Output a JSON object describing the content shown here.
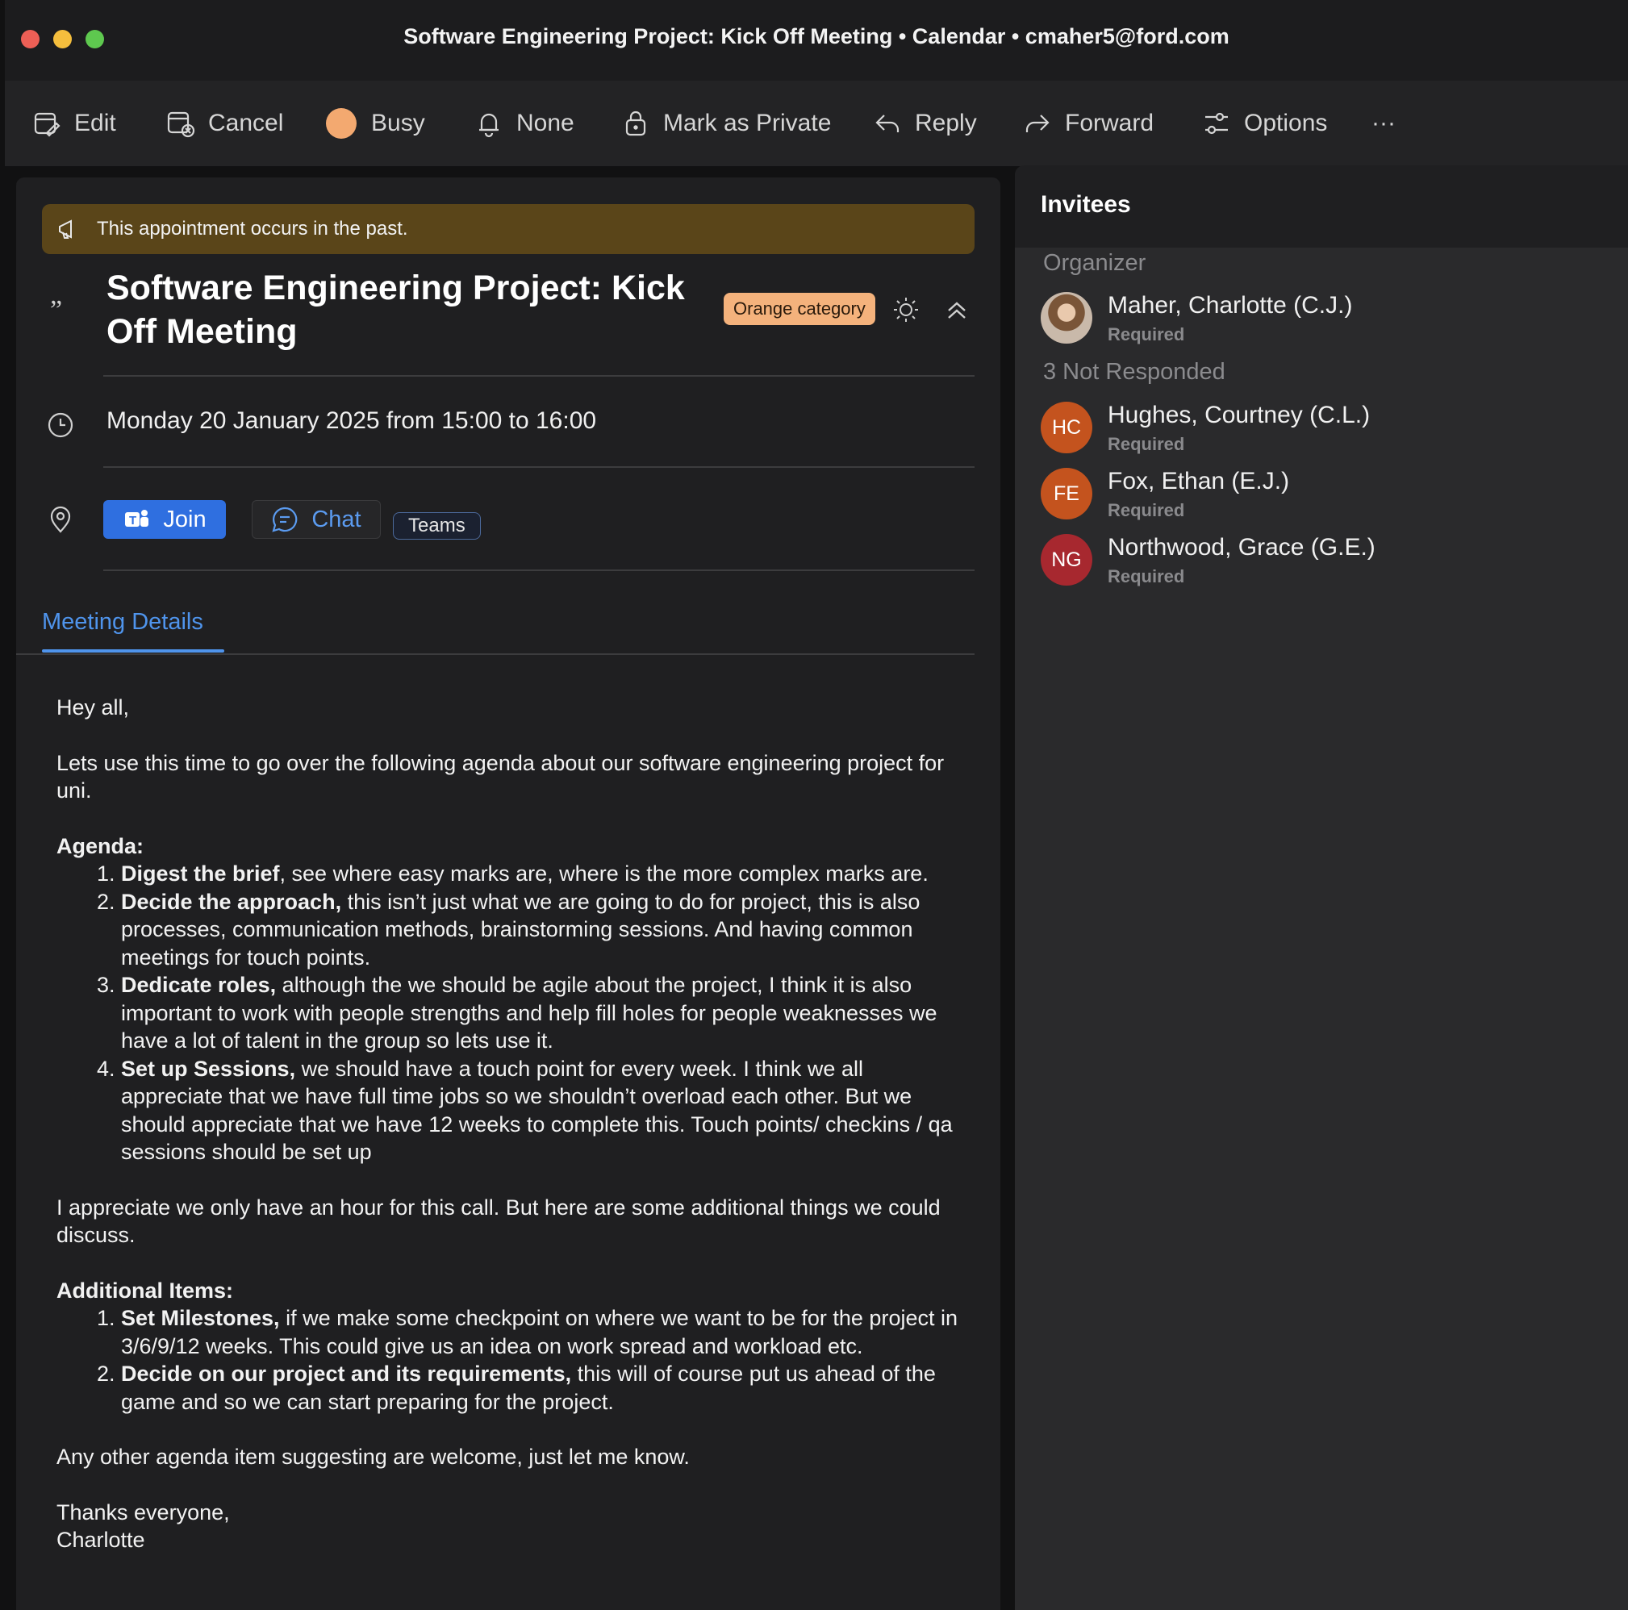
{
  "window": {
    "title": "Software Engineering Project: Kick Off Meeting • Calendar • cmaher5@ford.com"
  },
  "toolbar": {
    "edit_label": "Edit",
    "cancel_label": "Cancel",
    "busy_label": "Busy",
    "busy_color": "#f3a970",
    "reminder_label": "None",
    "private_label": "Mark as Private",
    "reply_label": "Reply",
    "forward_label": "Forward",
    "options_label": "Options",
    "more_label": "···"
  },
  "banner": {
    "text": "This appointment occurs in the past.",
    "icon": "megaphone-icon"
  },
  "event": {
    "subject": "Software Engineering Project: Kick Off Meeting",
    "category_label": "Orange category",
    "category_color": "#f4b27c",
    "datetime": "Monday 20 January 2025 from 15:00 to 16:00",
    "join_label": "Join",
    "chat_label": "Chat",
    "location_tag": "Teams"
  },
  "tabs": {
    "details_label": "Meeting Details"
  },
  "body": {
    "greeting": "Hey all,",
    "intro": "Lets use this time to go over the following agenda about our software engineering project for uni.",
    "agenda_heading": "Agenda:",
    "agenda": [
      {
        "bold": "Digest the brief",
        "text": ", see where easy marks are, where is the more complex marks are."
      },
      {
        "bold": "Decide the approach,",
        "text": " this isn’t just what we are going to do for project, this is also processes, communication methods, brainstorming sessions. And having common meetings for touch points."
      },
      {
        "bold": "Dedicate roles,",
        "text": " although the we should be agile about the project, I think it is also important to work with people strengths and help fill holes for people weaknesses we have a lot of talent in the group so lets use it."
      },
      {
        "bold": "Set up Sessions,",
        "text": " we should have a touch point for every week. I think we all appreciate that we have full time jobs so we shouldn’t overload each other. But we should appreciate that we have 12 weeks to complete this. Touch points/ checkins / qa sessions should be set up"
      }
    ],
    "hour_note": "I appreciate we only have an hour for this call. But here are some additional things we could discuss.",
    "additional_heading": "Additional Items:",
    "additional": [
      {
        "bold": "Set Milestones,",
        "text": " if we make some checkpoint on where we want to be for the project in 3/6/9/12 weeks. This could give us an idea on work spread and workload etc."
      },
      {
        "bold": "Decide on our project and its requirements,",
        "text": " this will of course put us ahead of the game and so we can start preparing for the project."
      }
    ],
    "closing_note": "Any other agenda item suggesting are welcome, just let me know.",
    "signoff": "Thanks everyone,",
    "signature": "Charlotte"
  },
  "invitees": {
    "title": "Invitees",
    "organizer_label": "Organizer",
    "organizer": {
      "name": "Maher, Charlotte (C.J.)",
      "role": "Required"
    },
    "not_responded_label": "3 Not Responded",
    "people": [
      {
        "initials": "HC",
        "name": "Hughes, Courtney (C.L.)",
        "role": "Required",
        "color": "#c4531e"
      },
      {
        "initials": "FE",
        "name": "Fox, Ethan (E.J.)",
        "role": "Required",
        "color": "#c4531e"
      },
      {
        "initials": "NG",
        "name": "Northwood, Grace (G.E.)",
        "role": "Required",
        "color": "#a7282f"
      }
    ]
  }
}
